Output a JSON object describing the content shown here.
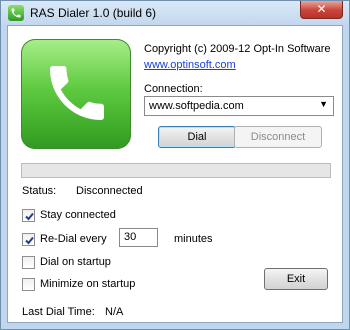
{
  "window": {
    "title": "RAS Dialer 1.0 (build 6)",
    "close_symbol": "✕"
  },
  "about": {
    "copyright": "Copyright (c) 2009-12 Opt-In Software",
    "website": "www.optinsoft.com"
  },
  "connection": {
    "label": "Connection:",
    "value": "www.softpedia.com"
  },
  "buttons": {
    "dial": "Dial",
    "disconnect": "Disconnect",
    "exit": "Exit"
  },
  "progress": {
    "fraction": 0
  },
  "status": {
    "label": "Status:",
    "value": "Disconnected"
  },
  "options": {
    "stay_connected": {
      "label": "Stay connected",
      "checked": true
    },
    "redial": {
      "label": "Re-Dial every",
      "checked": true,
      "value": "30",
      "unit": "minutes"
    },
    "dial_on_startup": {
      "label": "Dial on startup",
      "checked": false
    },
    "minimize_on_startup": {
      "label": "Minimize on startup",
      "checked": false
    }
  },
  "last_dial": {
    "label": "Last Dial Time:",
    "value": "N/A"
  },
  "colors": {
    "accent_green": "#37b02f",
    "link_blue": "#1a3fd0",
    "frame_blue": "#bfd6ec"
  },
  "icons": {
    "app": "phone-icon",
    "large": "phone-icon",
    "close": "close-icon"
  }
}
